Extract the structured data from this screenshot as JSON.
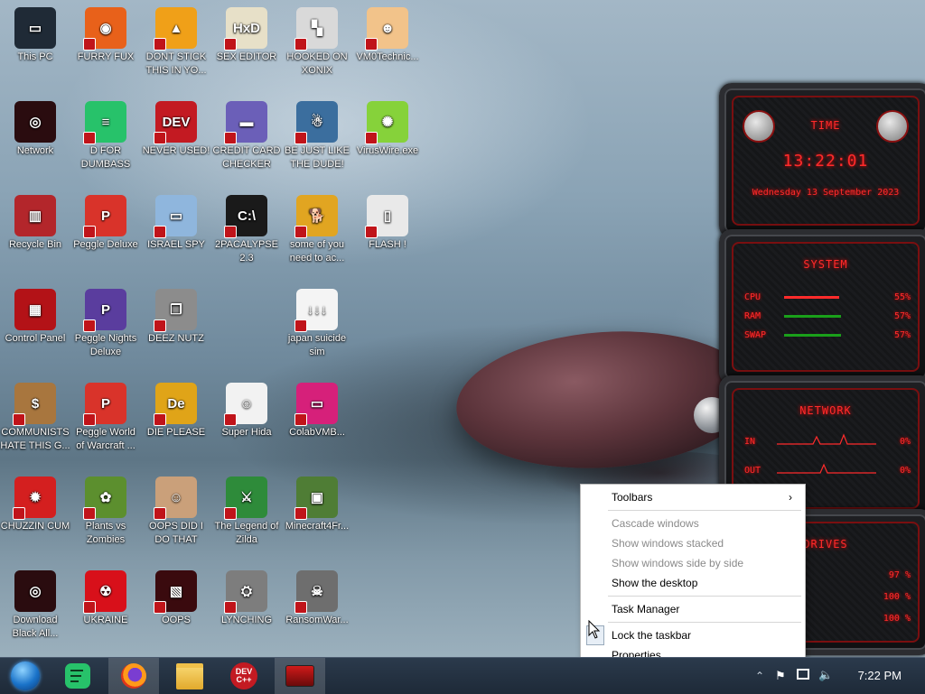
{
  "desktop": {
    "icons": [
      {
        "label": "This PC",
        "color": "#1f2a36",
        "glyph": "▭"
      },
      {
        "label": "FURRY FUX",
        "color": "#e8611a",
        "glyph": "◉"
      },
      {
        "label": "DONT STICK THIS IN YO...",
        "color": "#f0a018",
        "glyph": "▲"
      },
      {
        "label": "SEX EDITOR",
        "color": "#e7e0c8",
        "glyph": "HxD"
      },
      {
        "label": "HOOKED ON XONIX",
        "color": "#d9d9d9",
        "glyph": "▚"
      },
      {
        "label": "VM0Technic...",
        "color": "#f2c38a",
        "glyph": "☻"
      },
      {
        "label": "Network",
        "color": "#2a0c0f",
        "glyph": "◎"
      },
      {
        "label": "D FOR DUMBASS",
        "color": "#27c26a",
        "glyph": "≡"
      },
      {
        "label": "NEVER USED!",
        "color": "#c31a22",
        "glyph": "DEV"
      },
      {
        "label": "CREDIT CARD CHECKER",
        "color": "#6b5fb8",
        "glyph": "▬"
      },
      {
        "label": "BE JUST LIKE THE DUDE!",
        "color": "#3b6e9e",
        "glyph": "☃"
      },
      {
        "label": "VirusWire.exe",
        "color": "#86d23a",
        "glyph": "✺"
      },
      {
        "label": "Recycle Bin",
        "color": "#b3262b",
        "glyph": "▥"
      },
      {
        "label": "Peggle Deluxe",
        "color": "#d9332a",
        "glyph": "P"
      },
      {
        "label": "ISRAEL SPY",
        "color": "#8fb6dd",
        "glyph": "▭"
      },
      {
        "label": "2PACALYPSE 2.3",
        "color": "#1a1a1a",
        "glyph": "C:\\"
      },
      {
        "label": "some of you need to ac...",
        "color": "#e1a521",
        "glyph": "🐕"
      },
      {
        "label": "FLASH !",
        "color": "#e9e9e9",
        "glyph": "▯"
      },
      {
        "label": "Control Panel",
        "color": "#b31217",
        "glyph": "▦"
      },
      {
        "label": "Peggle Nights Deluxe",
        "color": "#5a3d9e",
        "glyph": "P"
      },
      {
        "label": "DEEZ NUTZ",
        "color": "#8c8c8c",
        "glyph": "❐"
      },
      {
        "label": "",
        "color": "#000",
        "glyph": ""
      },
      {
        "label": "japan suicide sim",
        "color": "#f4f4f4",
        "glyph": "↓↓↓"
      },
      {
        "label": "",
        "color": "#000",
        "glyph": ""
      },
      {
        "label": "COMMUNISTS HATE THIS G...",
        "color": "#a8763e",
        "glyph": "$"
      },
      {
        "label": "Peggle World of Warcraft ...",
        "color": "#d9332a",
        "glyph": "P"
      },
      {
        "label": "DIE PLEASE",
        "color": "#e0a418",
        "glyph": "De"
      },
      {
        "label": "Super Hida",
        "color": "#f2f2f2",
        "glyph": "☺"
      },
      {
        "label": "ColabVMB...",
        "color": "#d6207a",
        "glyph": "▭"
      },
      {
        "label": "",
        "color": "#000",
        "glyph": ""
      },
      {
        "label": "CHUZZIN CUM",
        "color": "#d41f1f",
        "glyph": "✹"
      },
      {
        "label": "Plants vs Zombies",
        "color": "#5c8f2e",
        "glyph": "✿"
      },
      {
        "label": "OOPS DID I DO THAT",
        "color": "#caa07a",
        "glyph": "☺"
      },
      {
        "label": "The Legend of Zilda",
        "color": "#2e8b3a",
        "glyph": "⚔"
      },
      {
        "label": "Minecraft4Fr...",
        "color": "#4f7d35",
        "glyph": "▣"
      },
      {
        "label": "",
        "color": "#000",
        "glyph": ""
      },
      {
        "label": "Download Black All...",
        "color": "#2a0c0f",
        "glyph": "◎"
      },
      {
        "label": "UKRAINE",
        "color": "#d8101a",
        "glyph": "☢"
      },
      {
        "label": "OOPS",
        "color": "#3a0a0e",
        "glyph": "▧"
      },
      {
        "label": "LYNCHING",
        "color": "#7d7d7d",
        "glyph": "⛭"
      },
      {
        "label": "RansomWar...",
        "color": "#6e6e6e",
        "glyph": "☠"
      },
      {
        "label": "",
        "color": "#000",
        "glyph": ""
      }
    ]
  },
  "gadget": {
    "time_panel": {
      "title": "TIME",
      "time": "13:22:01",
      "date": "Wednesday 13 September 2023"
    },
    "system_panel": {
      "title": "SYSTEM",
      "rows": [
        {
          "label": "CPU",
          "value": "55%",
          "level": 0.55
        },
        {
          "label": "RAM",
          "value": "57%",
          "level": 0.57
        },
        {
          "label": "SWAP",
          "value": "57%",
          "level": 0.57
        }
      ]
    },
    "network_panel": {
      "title": "NETWORK",
      "rows": [
        {
          "label": "IN",
          "value": "0%"
        },
        {
          "label": "OUT",
          "value": "0%"
        }
      ]
    },
    "drives_panel": {
      "title": "DRIVES",
      "rows": [
        {
          "value": "97 %"
        },
        {
          "value": "100 %"
        },
        {
          "value": "100 %"
        }
      ]
    }
  },
  "context_menu": {
    "items": [
      {
        "label": "Toolbars",
        "enabled": true,
        "submenu": true
      },
      {
        "label": "Cascade windows",
        "enabled": false
      },
      {
        "label": "Show windows stacked",
        "enabled": false
      },
      {
        "label": "Show windows side by side",
        "enabled": false
      },
      {
        "label": "Show the desktop",
        "enabled": true
      },
      {
        "label": "Task Manager",
        "enabled": true
      },
      {
        "label": "Lock the taskbar",
        "enabled": true
      },
      {
        "label": "Properties",
        "enabled": true
      }
    ]
  },
  "taskbar": {
    "apps": [
      {
        "name": "start-orb"
      },
      {
        "name": "spotify-like-app"
      },
      {
        "name": "firefox"
      },
      {
        "name": "file-explorer"
      },
      {
        "name": "dev-cpp"
      },
      {
        "name": "red-app"
      }
    ],
    "tray": {
      "time": "7:22 PM"
    }
  },
  "colors": {
    "accent_red": "#ff2b2b",
    "taskbar": "#243244",
    "menu_bg": "#ffffff"
  }
}
